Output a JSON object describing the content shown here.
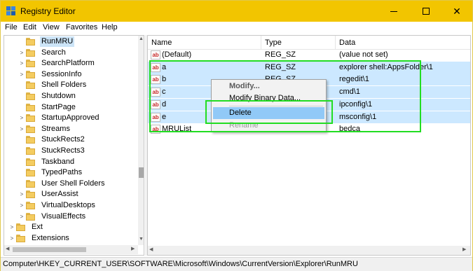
{
  "window": {
    "title": "Registry Editor",
    "accent_color": "#f2c500"
  },
  "menu": [
    "File",
    "Edit",
    "View",
    "Favorites",
    "Help"
  ],
  "tree": {
    "selected": "RunMRU",
    "items": [
      {
        "label": "RunMRU",
        "expander": ""
      },
      {
        "label": "Search",
        "expander": ">"
      },
      {
        "label": "SearchPlatform",
        "expander": ">"
      },
      {
        "label": "SessionInfo",
        "expander": ">"
      },
      {
        "label": "Shell Folders",
        "expander": ""
      },
      {
        "label": "Shutdown",
        "expander": ""
      },
      {
        "label": "StartPage",
        "expander": ""
      },
      {
        "label": "StartupApproved",
        "expander": ">"
      },
      {
        "label": "Streams",
        "expander": ">"
      },
      {
        "label": "StuckRects2",
        "expander": ""
      },
      {
        "label": "StuckRects3",
        "expander": ""
      },
      {
        "label": "Taskband",
        "expander": ""
      },
      {
        "label": "TypedPaths",
        "expander": ""
      },
      {
        "label": "User Shell Folders",
        "expander": ""
      },
      {
        "label": "UserAssist",
        "expander": ">"
      },
      {
        "label": "VirtualDesktops",
        "expander": ">"
      },
      {
        "label": "VisualEffects",
        "expander": ">"
      },
      {
        "label": "Ext",
        "expander": ">"
      },
      {
        "label": "Extensions",
        "expander": ">"
      }
    ]
  },
  "list": {
    "columns": [
      "Name",
      "Type",
      "Data"
    ],
    "rows": [
      {
        "name": "(Default)",
        "type": "REG_SZ",
        "data": "(value not set)",
        "selected": false
      },
      {
        "name": "a",
        "type": "REG_SZ",
        "data": "explorer shell:AppsFolder\\1",
        "selected": true
      },
      {
        "name": "b",
        "type": "REG_SZ",
        "data": "regedit\\1",
        "selected": true
      },
      {
        "name": "c",
        "type": "",
        "data": "cmd\\1",
        "selected": true
      },
      {
        "name": "d",
        "type": "",
        "data": "ipconfig\\1",
        "selected": true
      },
      {
        "name": "e",
        "type": "",
        "data": "msconfig\\1",
        "selected": true
      },
      {
        "name": "MRUList",
        "type": "",
        "data": "bedca",
        "selected": false
      }
    ]
  },
  "context_menu": {
    "items": [
      "Modify...",
      "Modify Binary Data...",
      "Delete",
      "Rename"
    ],
    "highlighted": "Delete"
  },
  "status": {
    "path": "Computer\\HKEY_CURRENT_USER\\SOFTWARE\\Microsoft\\Windows\\CurrentVersion\\Explorer\\RunMRU"
  },
  "annotation_color": "#22dd22",
  "icons": {
    "app": "registry-icon",
    "folder": "folder-icon",
    "value": "string-value-icon"
  }
}
